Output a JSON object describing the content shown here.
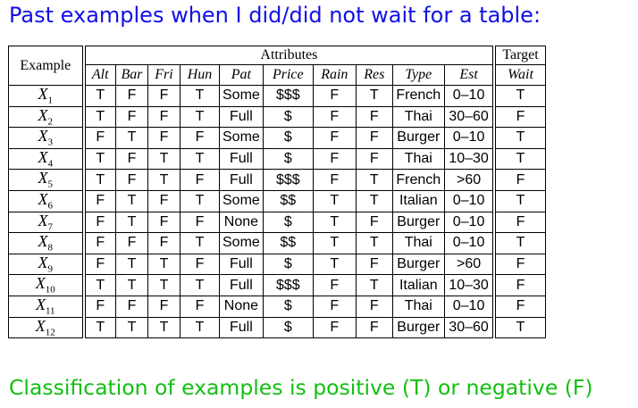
{
  "heading": "Past examples when I did/did not wait for a table:",
  "footer": "Classification of examples is positive (T) or negative (F)",
  "table": {
    "example_header": "Example",
    "attributes_header": "Attributes",
    "target_header": "Target",
    "attributes": [
      "Alt",
      "Bar",
      "Fri",
      "Hun",
      "Pat",
      "Price",
      "Rain",
      "Res",
      "Type",
      "Est"
    ],
    "target": "Wait",
    "rows": [
      {
        "ex": "X",
        "idx": "1",
        "v": [
          "T",
          "F",
          "F",
          "T",
          "Some",
          "$$$",
          "F",
          "T",
          "French",
          "0–10"
        ],
        "wait": "T"
      },
      {
        "ex": "X",
        "idx": "2",
        "v": [
          "T",
          "F",
          "F",
          "T",
          "Full",
          "$",
          "F",
          "F",
          "Thai",
          "30–60"
        ],
        "wait": "F"
      },
      {
        "ex": "X",
        "idx": "3",
        "v": [
          "F",
          "T",
          "F",
          "F",
          "Some",
          "$",
          "F",
          "F",
          "Burger",
          "0–10"
        ],
        "wait": "T"
      },
      {
        "ex": "X",
        "idx": "4",
        "v": [
          "T",
          "F",
          "T",
          "T",
          "Full",
          "$",
          "F",
          "F",
          "Thai",
          "10–30"
        ],
        "wait": "T"
      },
      {
        "ex": "X",
        "idx": "5",
        "v": [
          "T",
          "F",
          "T",
          "F",
          "Full",
          "$$$",
          "F",
          "T",
          "French",
          ">60"
        ],
        "wait": "F"
      },
      {
        "ex": "X",
        "idx": "6",
        "v": [
          "F",
          "T",
          "F",
          "T",
          "Some",
          "$$",
          "T",
          "T",
          "Italian",
          "0–10"
        ],
        "wait": "T"
      },
      {
        "ex": "X",
        "idx": "7",
        "v": [
          "F",
          "T",
          "F",
          "F",
          "None",
          "$",
          "T",
          "F",
          "Burger",
          "0–10"
        ],
        "wait": "F"
      },
      {
        "ex": "X",
        "idx": "8",
        "v": [
          "F",
          "F",
          "F",
          "T",
          "Some",
          "$$",
          "T",
          "T",
          "Thai",
          "0–10"
        ],
        "wait": "T"
      },
      {
        "ex": "X",
        "idx": "9",
        "v": [
          "F",
          "T",
          "T",
          "F",
          "Full",
          "$",
          "T",
          "F",
          "Burger",
          ">60"
        ],
        "wait": "F"
      },
      {
        "ex": "X",
        "idx": "10",
        "v": [
          "T",
          "T",
          "T",
          "T",
          "Full",
          "$$$",
          "F",
          "T",
          "Italian",
          "10–30"
        ],
        "wait": "F"
      },
      {
        "ex": "X",
        "idx": "11",
        "v": [
          "F",
          "F",
          "F",
          "F",
          "None",
          "$",
          "F",
          "F",
          "Thai",
          "0–10"
        ],
        "wait": "F"
      },
      {
        "ex": "X",
        "idx": "12",
        "v": [
          "T",
          "T",
          "T",
          "T",
          "Full",
          "$",
          "F",
          "F",
          "Burger",
          "30–60"
        ],
        "wait": "T"
      }
    ]
  }
}
